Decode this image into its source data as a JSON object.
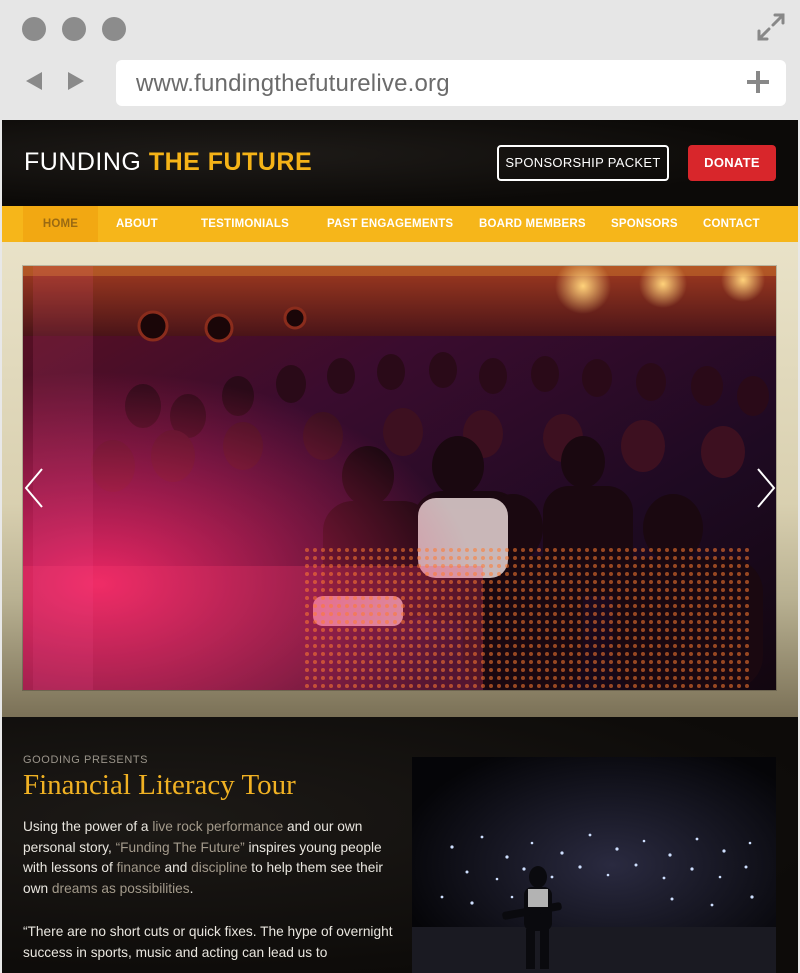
{
  "browser": {
    "url": "www.fundingthefuturelive.org",
    "icons": [
      "window-dot-icon",
      "expand-icon",
      "back-arrow-icon",
      "forward-arrow-icon",
      "plus-icon"
    ]
  },
  "header": {
    "logo_part1": "FUNDING ",
    "logo_part2": "THE FUTURE",
    "sponsorship_button": "SPONSORSHIP PACKET",
    "donate_button": "DONATE"
  },
  "nav": {
    "items": [
      "HOME",
      "ABOUT",
      "TESTIMONIALS",
      "PAST ENGAGEMENTS",
      "BOARD MEMBERS",
      "SPONSORS",
      "CONTACT"
    ],
    "active": "HOME"
  },
  "hero": {
    "image": "concert-audience-photo",
    "prev_icon": "chevron-left-icon",
    "next_icon": "chevron-right-icon"
  },
  "content": {
    "kicker": "GOODING PRESENTS",
    "title": "Financial Literacy Tour",
    "para": {
      "t1": "Using the power of a ",
      "h1": "live rock performance",
      "t2": " and our own personal story, ",
      "h2": "“Funding The Future”",
      "t3": " inspires young people with lessons of ",
      "h3": "finance",
      "t4": " and ",
      "h4": "discipline",
      "t5": " to help them see their own ",
      "h5": "dreams as possibilities",
      "t6": "."
    },
    "quote": "“There are no short cuts or quick fixes. The hype of overnight success in sports, music and acting can lead us to",
    "photo": "stage-performance-photo"
  },
  "colors": {
    "accent_yellow": "#f6b61a",
    "donate_red": "#d8262b",
    "title_gold": "#f0b123",
    "page_dark": "#0d0b09"
  }
}
